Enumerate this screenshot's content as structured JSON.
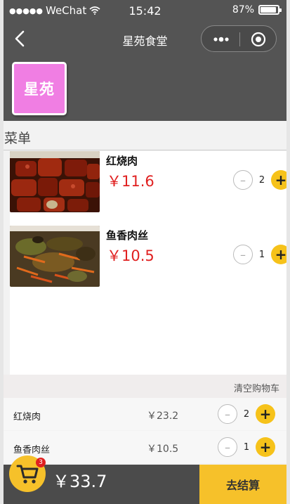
{
  "status_bar": {
    "carrier": "WeChat",
    "time": "15:42",
    "battery": "87%"
  },
  "nav": {
    "title": "星苑食堂"
  },
  "logo_text": "星苑",
  "menu_title": "菜单",
  "menu_items": [
    {
      "name": "红烧肉",
      "price": "￥11.6",
      "qty": "2"
    },
    {
      "name": "鱼香肉丝",
      "price": "￥10.5",
      "qty": "1"
    }
  ],
  "cart": {
    "clear_label": "清空购物车",
    "items": [
      {
        "name": "红烧肉",
        "price": "￥23.2",
        "qty": "2"
      },
      {
        "name": "鱼香肉丝",
        "price": "￥10.5",
        "qty": "1"
      }
    ],
    "count_badge": "3",
    "total": "￥33.7",
    "checkout_label": "去结算"
  },
  "colors": {
    "header": "#545454",
    "logo": "#f07ee3",
    "price": "#e02020",
    "accent": "#f6c12a"
  },
  "icons": [
    "back-arrow-icon",
    "more-dots-icon",
    "target-icon",
    "wifi-icon",
    "cart-icon",
    "minus-icon",
    "plus-icon"
  ]
}
